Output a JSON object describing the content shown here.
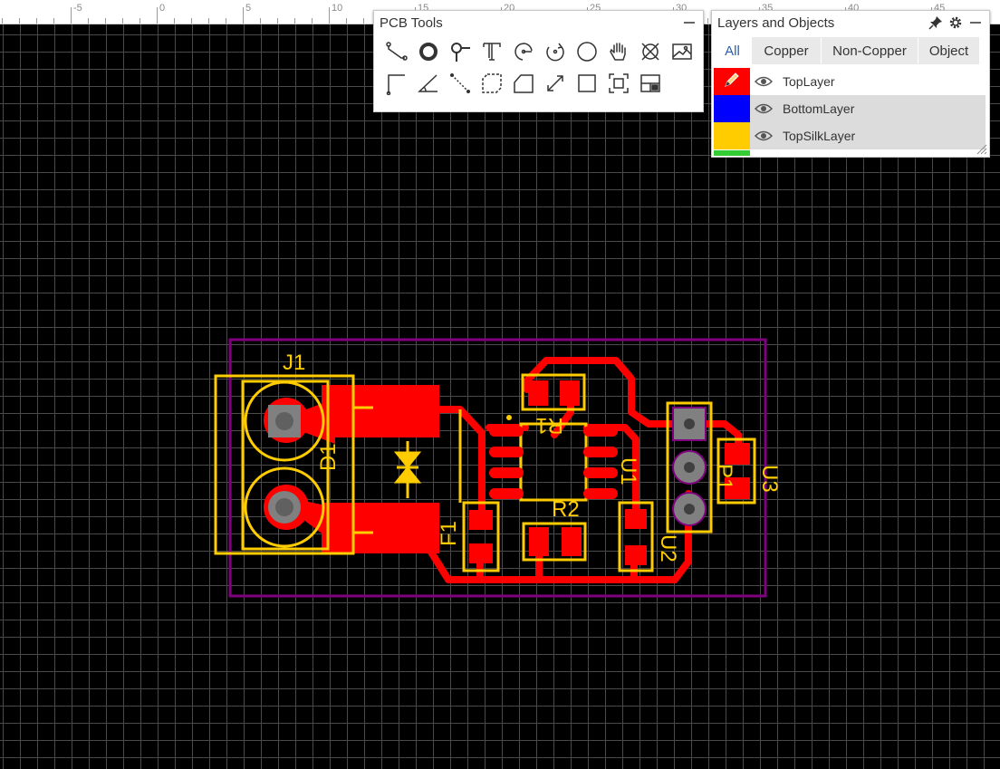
{
  "ruler": {
    "labels": [
      "-5",
      "0",
      "5",
      "10",
      "15",
      "20",
      "25",
      "30",
      "35",
      "40",
      "45"
    ]
  },
  "pcb_tools": {
    "title": "PCB Tools",
    "tools": [
      {
        "name": "track-tool",
        "icon": "track-icon"
      },
      {
        "name": "pad-tool",
        "icon": "pad-icon"
      },
      {
        "name": "via-tool",
        "icon": "via-icon"
      },
      {
        "name": "text-tool",
        "icon": "text-icon"
      },
      {
        "name": "arc-tool",
        "icon": "arc-icon"
      },
      {
        "name": "center-arc-tool",
        "icon": "center-arc-icon"
      },
      {
        "name": "circle-tool",
        "icon": "circle-icon"
      },
      {
        "name": "pan-tool",
        "icon": "hand-icon"
      },
      {
        "name": "hole-tool",
        "icon": "hole-icon"
      },
      {
        "name": "image-tool",
        "icon": "image-icon"
      },
      {
        "name": "line-tool",
        "icon": "line-corner-icon"
      },
      {
        "name": "angle-tool",
        "icon": "angle-icon"
      },
      {
        "name": "connect-tool",
        "icon": "connect-pad-icon"
      },
      {
        "name": "copper-area-tool",
        "icon": "dashed-area-icon"
      },
      {
        "name": "solid-region-tool",
        "icon": "solid-region-icon"
      },
      {
        "name": "dimension-tool",
        "icon": "dimension-icon"
      },
      {
        "name": "rectangle-tool",
        "icon": "rectangle-icon"
      },
      {
        "name": "canvas-origin-tool",
        "icon": "origin-icon"
      },
      {
        "name": "photo-view-tool",
        "icon": "photo-view-icon"
      }
    ]
  },
  "layers_panel": {
    "title": "Layers and Objects",
    "tabs": [
      {
        "label": "All",
        "active": true
      },
      {
        "label": "Copper",
        "active": false
      },
      {
        "label": "Non-Copper",
        "active": false
      },
      {
        "label": "Object",
        "active": false
      }
    ],
    "layers": [
      {
        "name": "TopLayer",
        "color": "#ff0000",
        "active": true,
        "visible": true
      },
      {
        "name": "BottomLayer",
        "color": "#0000ff",
        "active": false,
        "visible": true
      },
      {
        "name": "TopSilkLayer",
        "color": "#ffcc00",
        "active": false,
        "visible": true
      }
    ],
    "partial_layer_color": "#33cc33"
  },
  "pcb": {
    "colors": {
      "copper": "#ff0000",
      "silk": "#ffcc00",
      "outline": "#800080",
      "hole": "#808080"
    },
    "designators": [
      "J1",
      "D1",
      "F1",
      "R1",
      "R2",
      "U1",
      "U2",
      "U3",
      "P1"
    ]
  }
}
